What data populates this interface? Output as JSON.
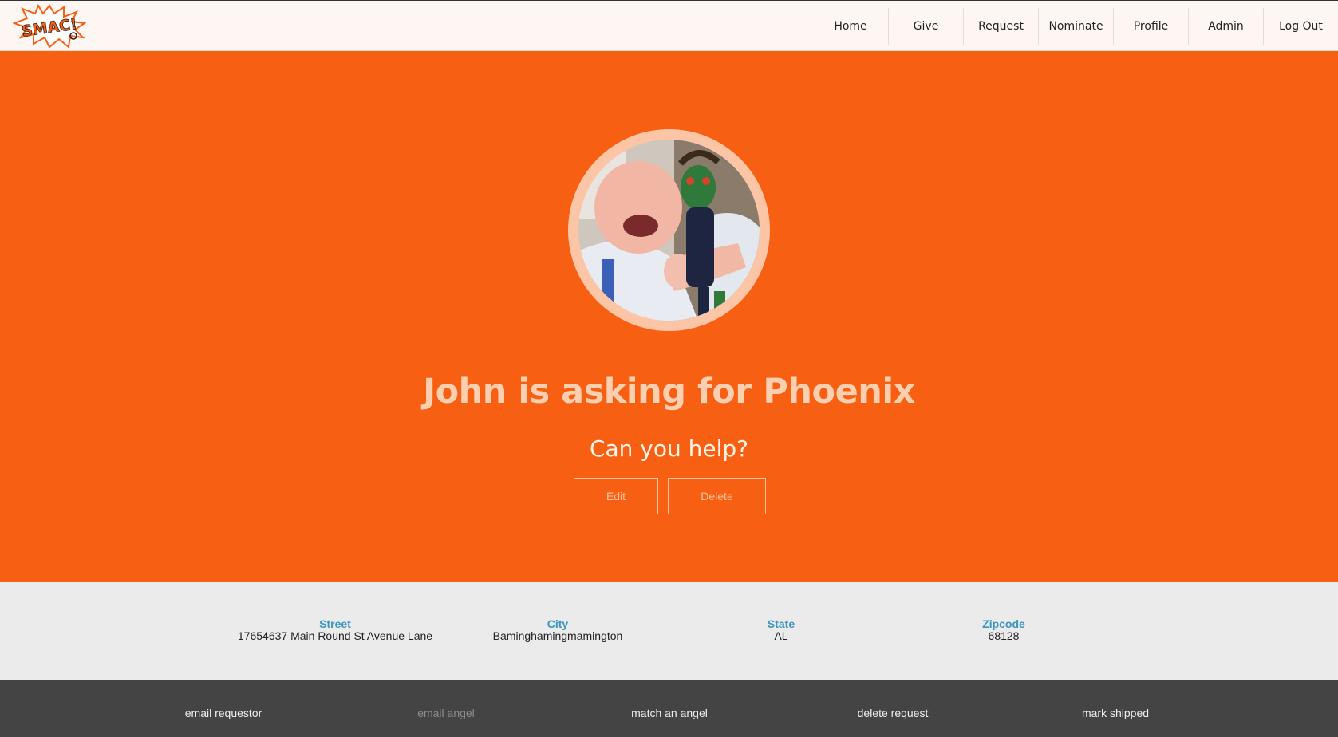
{
  "brand": {
    "logo_text": "SMAC!",
    "colors": {
      "primary": "#f76013",
      "label": "#3a95c0",
      "footer": "#444444"
    }
  },
  "nav": {
    "items": [
      {
        "label": "Home"
      },
      {
        "label": "Give"
      },
      {
        "label": "Request"
      },
      {
        "label": "Nominate"
      },
      {
        "label": "Profile"
      },
      {
        "label": "Admin"
      },
      {
        "label": "Log Out"
      }
    ]
  },
  "hero": {
    "title": "John is asking for Phoenix",
    "subtitle": "Can you help?",
    "edit_label": "Edit",
    "delete_label": "Delete"
  },
  "address": {
    "street": {
      "label": "Street",
      "value": "17654637 Main Round St Avenue Lane"
    },
    "city": {
      "label": "City",
      "value": "Baminghamingmamington"
    },
    "state": {
      "label": "State",
      "value": "AL"
    },
    "zipcode": {
      "label": "Zipcode",
      "value": "68128"
    }
  },
  "footer": {
    "email_requestor": "email requestor",
    "email_angel": "email angel",
    "match_angel": "match an angel",
    "delete_request": "delete request",
    "mark_shipped": "mark shipped"
  }
}
